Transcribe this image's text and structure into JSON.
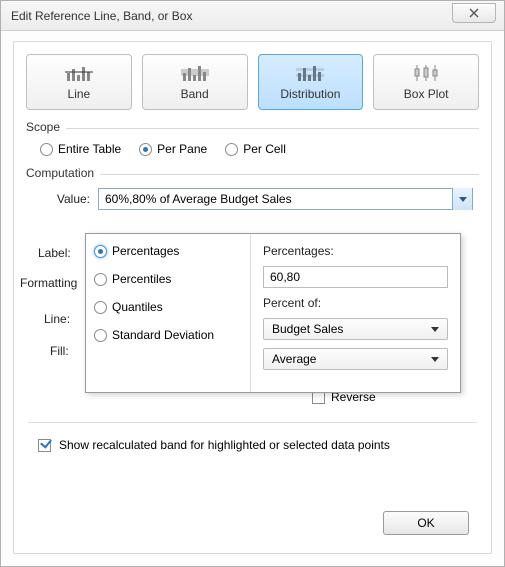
{
  "title": "Edit Reference Line, Band, or Box",
  "types": {
    "line": "Line",
    "band": "Band",
    "distribution": "Distribution",
    "boxplot": "Box Plot"
  },
  "scope": {
    "label": "Scope",
    "entire_table": "Entire Table",
    "per_pane": "Per Pane",
    "per_cell": "Per Cell"
  },
  "computation": {
    "label": "Computation",
    "value_label": "Value:",
    "value_text": "60%,80% of Average Budget Sales",
    "label_label": "Label:",
    "formatting_label": "Formatting",
    "line_label": "Line:",
    "fill_label": "Fill:"
  },
  "popup": {
    "opt_percentages": "Percentages",
    "opt_percentiles": "Percentiles",
    "opt_quantiles": "Quantiles",
    "opt_stddev": "Standard Deviation",
    "percentages_label": "Percentages:",
    "percentages_value": "60,80",
    "percent_of_label": "Percent of:",
    "percent_of_field": "Budget Sales",
    "percent_of_agg": "Average"
  },
  "reverse_label": "Reverse",
  "recalc_label": "Show recalculated band for highlighted or selected data points",
  "ok": "OK"
}
